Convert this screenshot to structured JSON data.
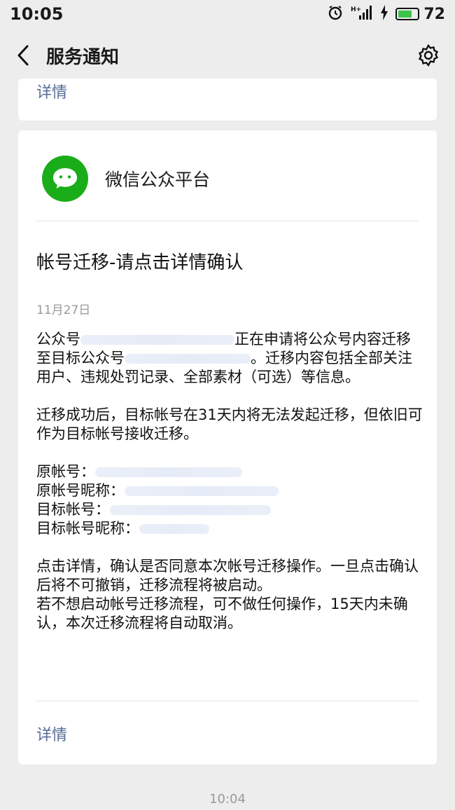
{
  "status_bar": {
    "time": "10:05",
    "battery_level": "72",
    "battery_fraction": 0.72,
    "network": "H+"
  },
  "nav": {
    "title": "服务通知"
  },
  "previous_card": {
    "detail_label": "详情"
  },
  "message": {
    "account_name": "微信公众平台",
    "title": "帐号迁移-请点击详情确认",
    "date": "11月27日",
    "p1_a": "公众号",
    "p1_b": "正在申请将公众号内容迁",
    "p1_c": "移至目标公众号",
    "p1_d": "。迁移内容包括全",
    "p1_e": "部关注用户、违规处罚记录、全部素材（可选）等信",
    "p1_f": "息。",
    "p2": "迁移成功后，目标帐号在31天内将无法发起迁移，但依旧可作为目标帐号接收迁移。",
    "field_original_account": "原帐号：",
    "field_original_nickname": "原帐号昵称：",
    "field_target_account": "目标帐号：",
    "field_target_nickname": "目标帐号昵称：",
    "p3_a": "点击详情，确认是否同意本次帐号迁移操作。一旦点击确认后将不可撤销，迁移流程将被启动。",
    "p3_b": "若不想启动帐号迁移流程，可不做任何操作，15天内未确认，本次迁移流程将自动取消。",
    "detail_label": "详情"
  },
  "bottom_time": "10:04",
  "colors": {
    "link": "#576b95",
    "brand_green": "#1aad19",
    "background": "#ededed"
  }
}
